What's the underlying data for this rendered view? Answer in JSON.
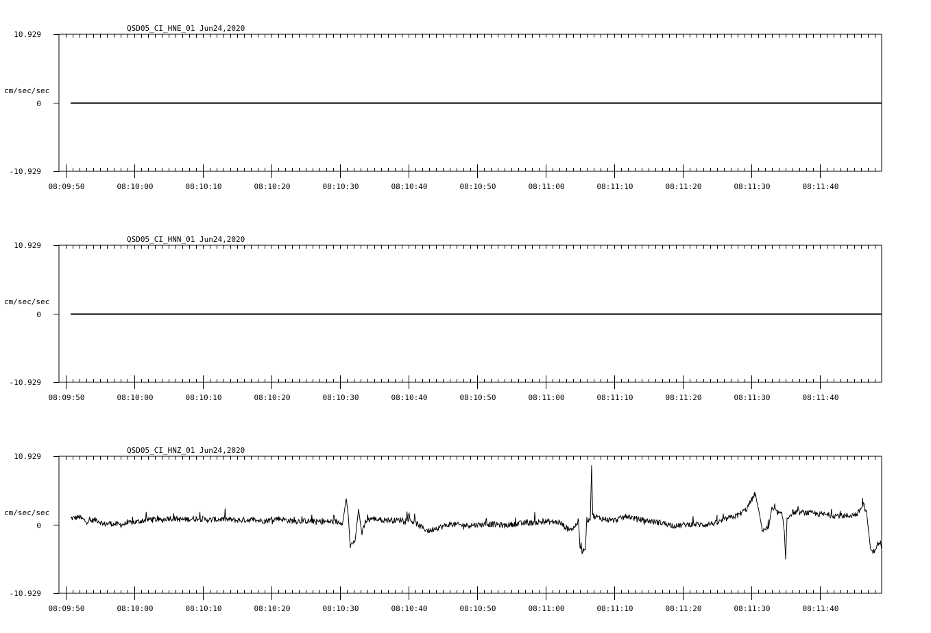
{
  "chart_data": [
    {
      "type": "line",
      "title": "QSD05_CI_HNE_01  Jun24,2020",
      "ylabel": "cm/sec/sec",
      "ylim": [
        -10.929,
        10.929
      ],
      "ytick_labels": [
        "10.929",
        "0",
        "-10.929"
      ],
      "x_tick_labels": [
        "08:09:50",
        "08:10:00",
        "08:10:10",
        "08:10:20",
        "08:10:30",
        "08:10:40",
        "08:10:50",
        "08:11:00",
        "08:11:10",
        "08:11:20",
        "08:11:30",
        "08:11:40"
      ],
      "x_start_sec": 0,
      "x_end_sec": 119,
      "signal": "flat",
      "points": [
        [
          0.7,
          0
        ],
        [
          119,
          0
        ]
      ]
    },
    {
      "type": "line",
      "title": "QSD05_CI_HNN_01  Jun24,2020",
      "ylabel": "cm/sec/sec",
      "ylim": [
        -10.929,
        10.929
      ],
      "ytick_labels": [
        "10.929",
        "0",
        "-10.929"
      ],
      "x_tick_labels": [
        "08:09:50",
        "08:10:00",
        "08:10:10",
        "08:10:20",
        "08:10:30",
        "08:10:40",
        "08:10:50",
        "08:11:00",
        "08:11:10",
        "08:11:20",
        "08:11:30",
        "08:11:40"
      ],
      "x_start_sec": 0,
      "x_end_sec": 119,
      "signal": "flat",
      "points": [
        [
          0.7,
          0
        ],
        [
          119,
          0
        ]
      ]
    },
    {
      "type": "line",
      "title": "QSD05_CI_HNZ_01  Jun24,2020",
      "ylabel": "cm/sec/sec",
      "ylim": [
        -10.929,
        10.929
      ],
      "ytick_labels": [
        "10.929",
        "0",
        "-10.929"
      ],
      "x_tick_labels": [
        "08:09:50",
        "08:10:00",
        "08:10:10",
        "08:10:20",
        "08:10:30",
        "08:10:40",
        "08:10:50",
        "08:11:00",
        "08:11:10",
        "08:11:20",
        "08:11:30",
        "08:11:40"
      ],
      "x_start_sec": 0,
      "x_end_sec": 119,
      "signal": "noisy",
      "points": [
        [
          0.7,
          1.0
        ],
        [
          2.0,
          1.2
        ],
        [
          3.0,
          0.5
        ],
        [
          4.5,
          0.8
        ],
        [
          5.5,
          0.1
        ],
        [
          6.5,
          0.2
        ],
        [
          8.0,
          0.0
        ],
        [
          9.5,
          0.3
        ],
        [
          11.0,
          0.6
        ],
        [
          12.5,
          0.9
        ],
        [
          14.0,
          0.7
        ],
        [
          15.0,
          1.1
        ],
        [
          17.0,
          0.8
        ],
        [
          19.0,
          1.0
        ],
        [
          21.0,
          0.8
        ],
        [
          23.0,
          0.9
        ],
        [
          25.0,
          0.7
        ],
        [
          27.0,
          0.8
        ],
        [
          29.0,
          0.6
        ],
        [
          31.0,
          1.0
        ],
        [
          33.0,
          0.6
        ],
        [
          35.0,
          0.6
        ],
        [
          37.0,
          0.5
        ],
        [
          39.0,
          0.5
        ],
        [
          40.4,
          0.4
        ],
        [
          40.9,
          4.2
        ],
        [
          41.2,
          1.5
        ],
        [
          41.5,
          -3.3
        ],
        [
          42.2,
          -2.5
        ],
        [
          42.7,
          2.5
        ],
        [
          43.2,
          -1.5
        ],
        [
          43.7,
          0.5
        ],
        [
          44.5,
          1.0
        ],
        [
          46.0,
          0.8
        ],
        [
          48.0,
          0.7
        ],
        [
          50.0,
          0.9
        ],
        [
          51.0,
          0.3
        ],
        [
          52.0,
          -0.5
        ],
        [
          53.0,
          -1.0
        ],
        [
          54.0,
          -0.5
        ],
        [
          55.0,
          -0.3
        ],
        [
          56.0,
          0.1
        ],
        [
          58.0,
          -0.1
        ],
        [
          60.0,
          0.0
        ],
        [
          62.0,
          0.1
        ],
        [
          64.0,
          -0.1
        ],
        [
          66.0,
          0.2
        ],
        [
          68.0,
          0.3
        ],
        [
          70.0,
          0.5
        ],
        [
          72.0,
          0.4
        ],
        [
          73.0,
          -0.5
        ],
        [
          74.0,
          -0.6
        ],
        [
          74.8,
          0.6
        ],
        [
          75.0,
          -3.5
        ],
        [
          75.3,
          -4.2
        ],
        [
          75.8,
          -3.6
        ],
        [
          76.0,
          0.8
        ],
        [
          76.3,
          0.9
        ],
        [
          76.5,
          1.0
        ],
        [
          76.7,
          9.5
        ],
        [
          76.85,
          1.4
        ],
        [
          77.5,
          1.2
        ],
        [
          78.5,
          0.9
        ],
        [
          80.0,
          0.7
        ],
        [
          82.0,
          1.4
        ],
        [
          83.0,
          1.0
        ],
        [
          85.0,
          0.6
        ],
        [
          87.0,
          0.3
        ],
        [
          89.0,
          -0.2
        ],
        [
          91.0,
          0.1
        ],
        [
          93.0,
          0.0
        ],
        [
          95.0,
          0.3
        ],
        [
          96.5,
          1.0
        ],
        [
          98.0,
          1.5
        ],
        [
          99.3,
          2.5
        ],
        [
          100.5,
          4.9
        ],
        [
          101.0,
          2.8
        ],
        [
          101.5,
          -0.7
        ],
        [
          102.5,
          -0.6
        ],
        [
          103.0,
          2.5
        ],
        [
          104.5,
          1.5
        ],
        [
          104.8,
          -1.0
        ],
        [
          105.0,
          -5.5
        ],
        [
          105.2,
          1.0
        ],
        [
          106.0,
          2.0
        ],
        [
          108.0,
          1.9
        ],
        [
          110.0,
          1.7
        ],
        [
          112.0,
          1.5
        ],
        [
          114.0,
          1.4
        ],
        [
          115.5,
          1.7
        ],
        [
          116.3,
          3.3
        ],
        [
          116.8,
          2.0
        ],
        [
          117.3,
          -3.5
        ],
        [
          117.7,
          -4.5
        ],
        [
          118.5,
          -3.0
        ],
        [
          119.0,
          -3.6
        ]
      ]
    }
  ]
}
